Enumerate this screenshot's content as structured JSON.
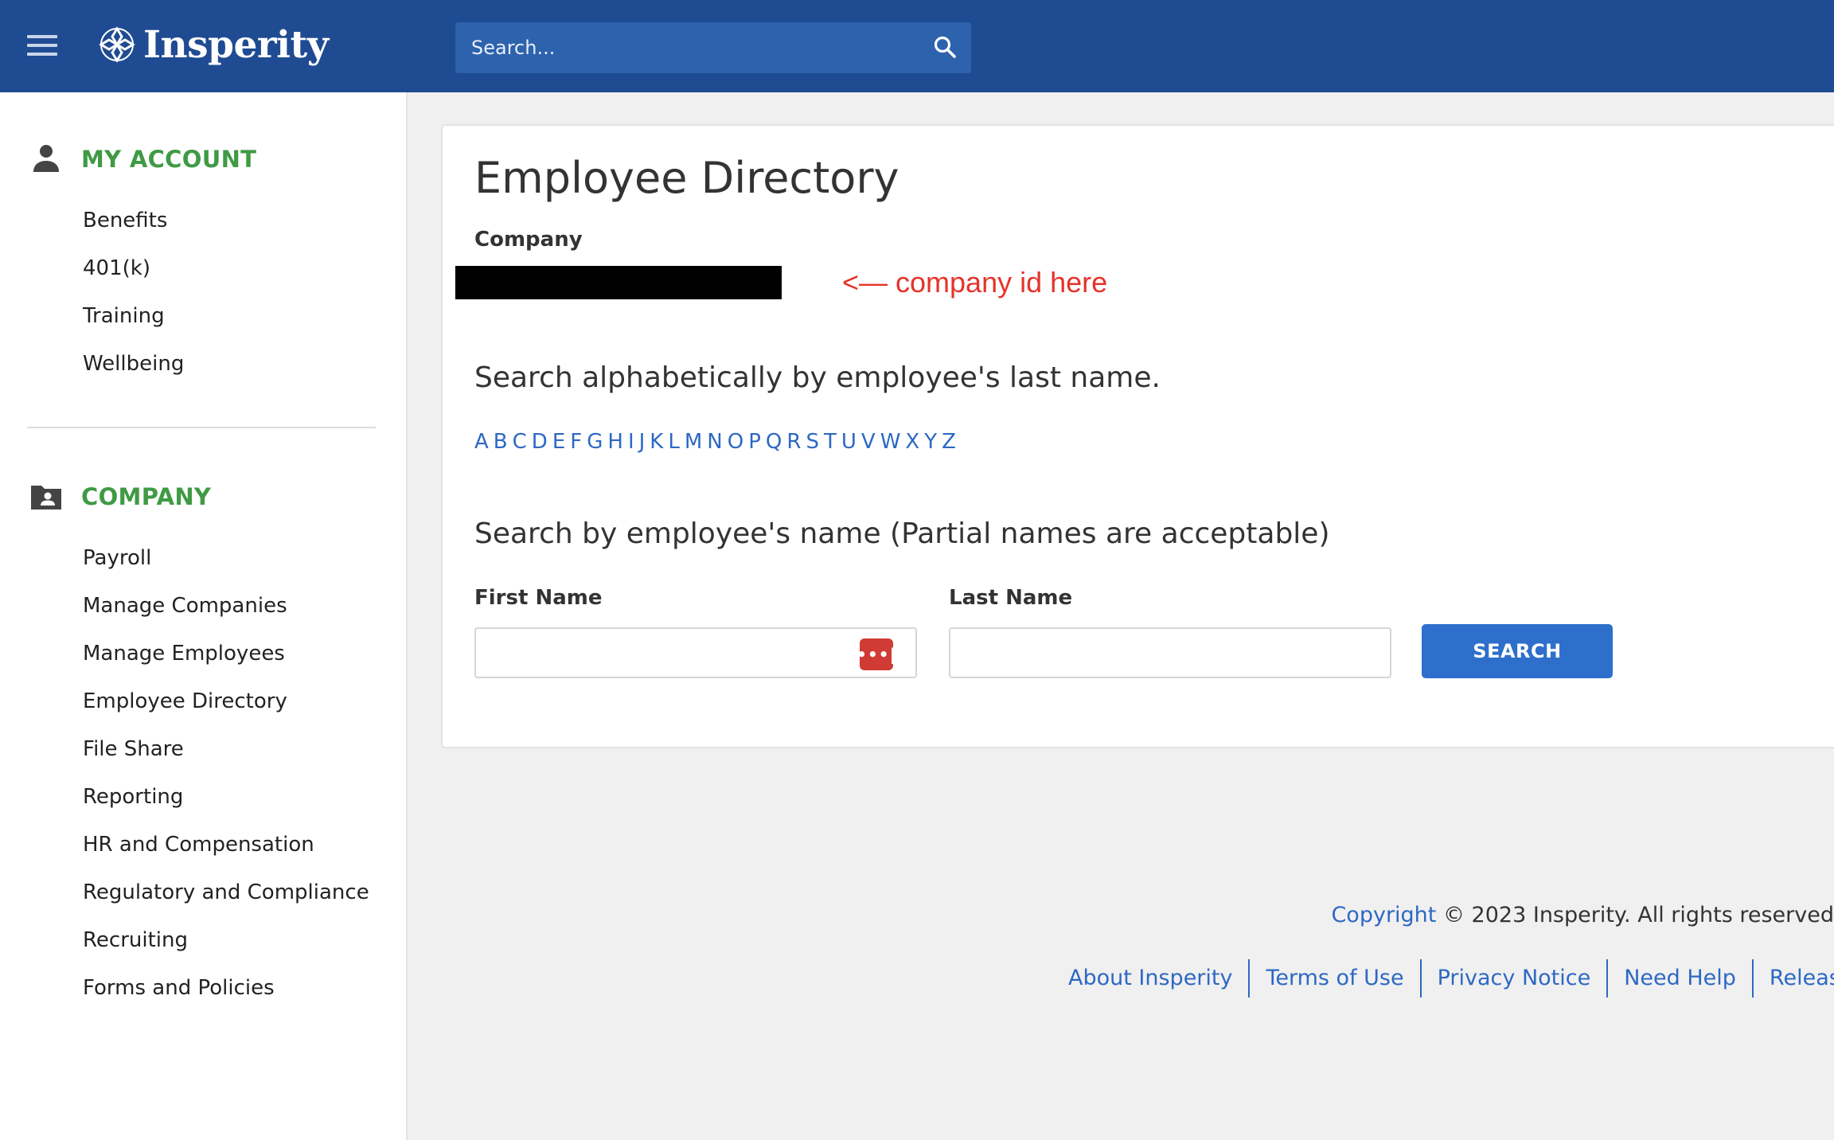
{
  "header": {
    "brand": "Insperity",
    "search_placeholder": "Search...",
    "colors": {
      "bar": "#1f4b92",
      "search_bg": "#2d62ad"
    }
  },
  "sidebar": {
    "my_account": {
      "title": "MY ACCOUNT",
      "icon": "person-icon",
      "items": [
        "Benefits",
        "401(k)",
        "Training",
        "Wellbeing"
      ]
    },
    "company": {
      "title": "COMPANY",
      "icon": "folder-person-icon",
      "items": [
        "Payroll",
        "Manage Companies",
        "Manage Employees",
        "Employee Directory",
        "File Share",
        "Reporting",
        "HR and Compensation",
        "Regulatory and Compliance",
        "Recruiting",
        "Forms and Policies"
      ]
    },
    "colors": {
      "section_title": "#3f9a44"
    }
  },
  "main": {
    "title": "Employee Directory",
    "company_label": "Company",
    "annotation": "<— company id here",
    "alpha_heading": "Search alphabetically by employee's last name.",
    "letters": [
      "A",
      "B",
      "C",
      "D",
      "E",
      "F",
      "G",
      "H",
      "I",
      "J",
      "K",
      "L",
      "M",
      "N",
      "O",
      "P",
      "Q",
      "R",
      "S",
      "T",
      "U",
      "V",
      "W",
      "X",
      "Y",
      "Z"
    ],
    "name_heading": "Search by employee's name (Partial names are acceptable)",
    "first_name_label": "First Name",
    "first_name_value": "",
    "last_name_label": "Last Name",
    "last_name_value": "",
    "search_button": "SEARCH",
    "colors": {
      "link": "#2d68c4",
      "button": "#2e6fcb",
      "annotation": "#e5332a",
      "password_manager_icon": "#d13b35"
    }
  },
  "footer": {
    "copyright_link": "Copyright",
    "copyright_text": " © 2023 Insperity. All rights reserved",
    "links": [
      "About Insperity",
      "Terms of Use",
      "Privacy Notice",
      "Need Help",
      "Release Not"
    ]
  }
}
